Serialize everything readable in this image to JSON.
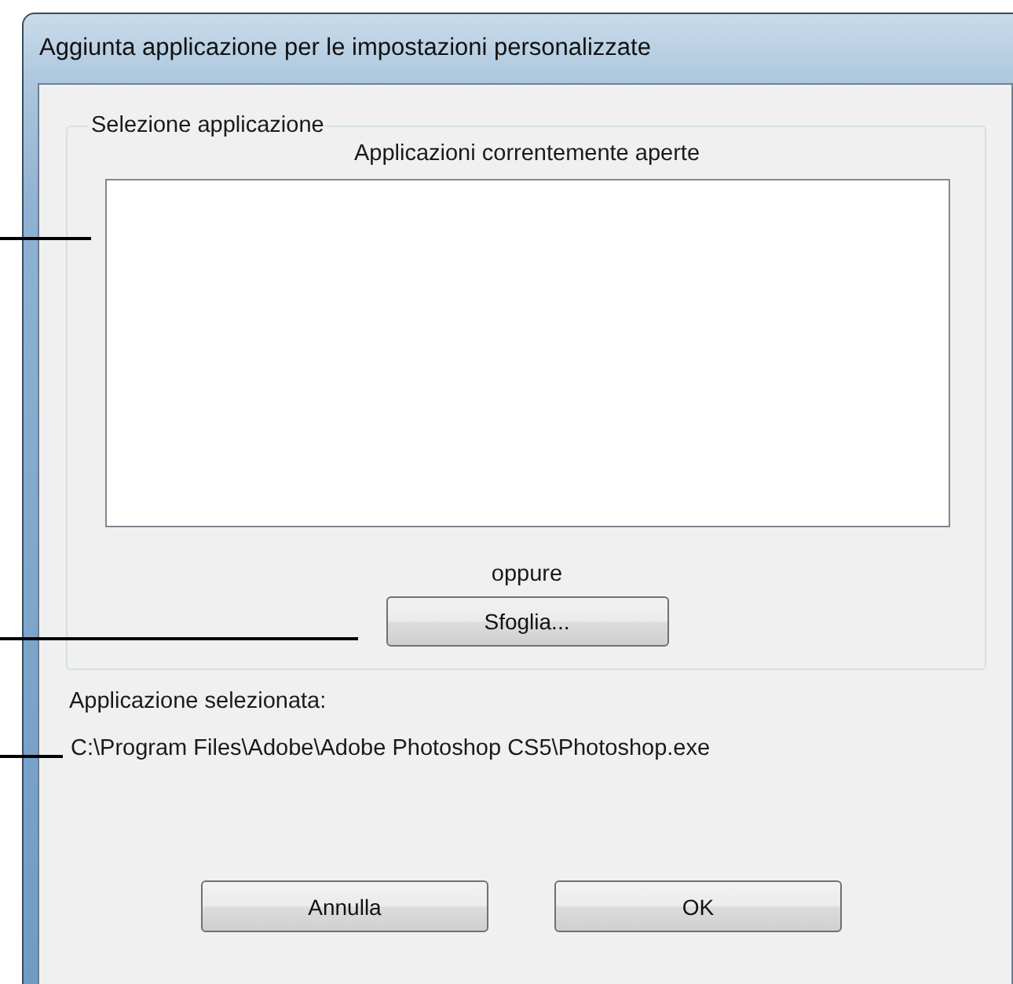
{
  "window": {
    "title": "Aggiunta applicazione per le impostazioni personalizzate"
  },
  "group": {
    "title": "Selezione applicazione",
    "list_label": "Applicazioni correntemente aperte",
    "separator": "oppure",
    "browse_button": "Sfoglia..."
  },
  "selected_label": "Applicazione selezionata:",
  "selected_path": "C:\\Program Files\\Adobe\\Adobe Photoshop CS5\\Photoshop.exe",
  "buttons": [
    "Annulla",
    "OK"
  ]
}
